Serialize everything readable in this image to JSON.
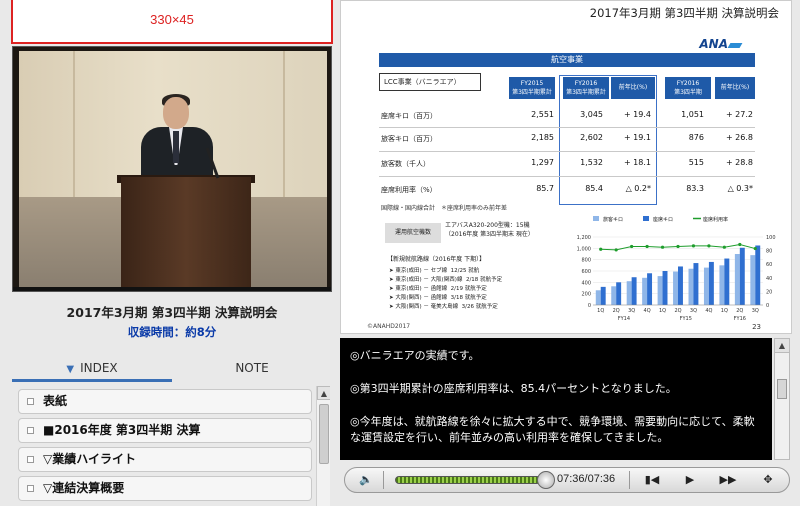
{
  "ad": {
    "label": "330×45"
  },
  "video_info": {
    "title": "2017年3月期 第3四半期 決算説明会",
    "duration": "収録時間：約8分"
  },
  "tabs": {
    "index_label": "INDEX",
    "note_label": "NOTE"
  },
  "index_items": [
    {
      "label": "表紙"
    },
    {
      "label": "■2016年度 第3四半期 決算"
    },
    {
      "label": "▽業績ハイライト"
    },
    {
      "label": "▽連結決算概要"
    }
  ],
  "slide": {
    "header": "2017年3月期 第3四半期 決算説明会",
    "logo": "ANA",
    "banner": "航空事業",
    "lcc_label": "LCC事業（バニラエア）",
    "col_fy15": "FY2015\n第3四半期累計",
    "col_fy16": "FY2016\n第3四半期累計",
    "col_yoy": "前年比(%)",
    "col_fy16q3": "FY2016\n第3四半期",
    "col_yoy2": "前年比(%)",
    "rows": [
      {
        "label": "座席キロ（百万）",
        "fy15": "2,551",
        "fy16": "3,045",
        "yoy": "+ 19.4",
        "q3": "1,051",
        "yoy2": "+ 27.2"
      },
      {
        "label": "旅客キロ（百万）",
        "fy15": "2,185",
        "fy16": "2,602",
        "yoy": "+ 19.1",
        "q3": "876",
        "yoy2": "+ 26.8"
      },
      {
        "label": "旅客数（千人）",
        "fy15": "1,297",
        "fy16": "1,532",
        "yoy": "+ 18.1",
        "q3": "515",
        "yoy2": "+ 28.8"
      },
      {
        "label": "座席利用率（%）",
        "fy15": "85.7",
        "fy16": "85.4",
        "yoy": "△ 0.2*",
        "q3": "83.3",
        "yoy2": "△ 0.3*"
      }
    ],
    "note_top": "国際線・国内線合計　＊座席利用率のみ前年差",
    "route_title": "運用航空機数",
    "route_text": "エアバスA320-200型機：15機\n（2016年度 第3四半期末 現在）",
    "routes_heading": "【新規就航路線（2016年度 下期）】",
    "routes": [
      {
        "text": "東京(成田) － セブ線",
        "date": "12/25",
        "status": "就航"
      },
      {
        "text": "東京(成田) － 大阪(関西)線",
        "date": "2/18",
        "status": "就航予定"
      },
      {
        "text": "東京(成田) － 函館線",
        "date": "2/19",
        "status": "就航予定"
      },
      {
        "text": "大阪(関西) － 函館線",
        "date": "3/18",
        "status": "就航予定"
      },
      {
        "text": "大阪(関西) － 奄美大島線",
        "date": "3/26",
        "status": "就航予定"
      }
    ],
    "copyright": "©ANAHD2017",
    "page": "23"
  },
  "chart_data": {
    "type": "bar",
    "title": "",
    "legend": [
      "旅客キロ",
      "座席キロ",
      "座席利用率"
    ],
    "categories": [
      "1Q",
      "2Q",
      "3Q",
      "4Q",
      "1Q",
      "2Q",
      "3Q",
      "4Q",
      "1Q",
      "2Q",
      "3Q"
    ],
    "groups": [
      "FY14",
      "FY15",
      "FY16"
    ],
    "series": [
      {
        "name": "旅客キロ",
        "values": [
          260,
          330,
          420,
          480,
          510,
          590,
          640,
          660,
          700,
          900,
          880
        ]
      },
      {
        "name": "座席キロ",
        "values": [
          320,
          400,
          490,
          560,
          600,
          680,
          740,
          760,
          820,
          1010,
          1050
        ]
      },
      {
        "name": "座席利用率",
        "values": [
          82,
          81,
          86,
          86,
          85,
          86,
          87,
          87,
          85,
          89,
          83
        ]
      }
    ],
    "ylim_left": [
      0,
      1200
    ],
    "ylim_right": [
      0,
      100
    ],
    "yticks_left": [
      "1,200",
      "1,000",
      "800",
      "600",
      "400",
      "200",
      "0"
    ],
    "yticks_right": [
      "100",
      "80",
      "60",
      "40",
      "20",
      "0"
    ],
    "colors": {
      "bar1": "#8fb6e8",
      "bar2": "#2f6fd0",
      "line": "#1e9d2c"
    }
  },
  "caption": {
    "lines": [
      "◎バニラエアの実績です。",
      "◎第3四半期累計の座席利用率は、85.4パーセントとなりました。",
      "◎今年度は、就航路線を徐々に拡大する中で、競争環境、需要動向に応じて、柔軟な運賃設定を行い、前年並みの高い利用率を確保してきました。"
    ]
  },
  "player": {
    "time": "07:36/07:36",
    "progress": 1.0
  }
}
